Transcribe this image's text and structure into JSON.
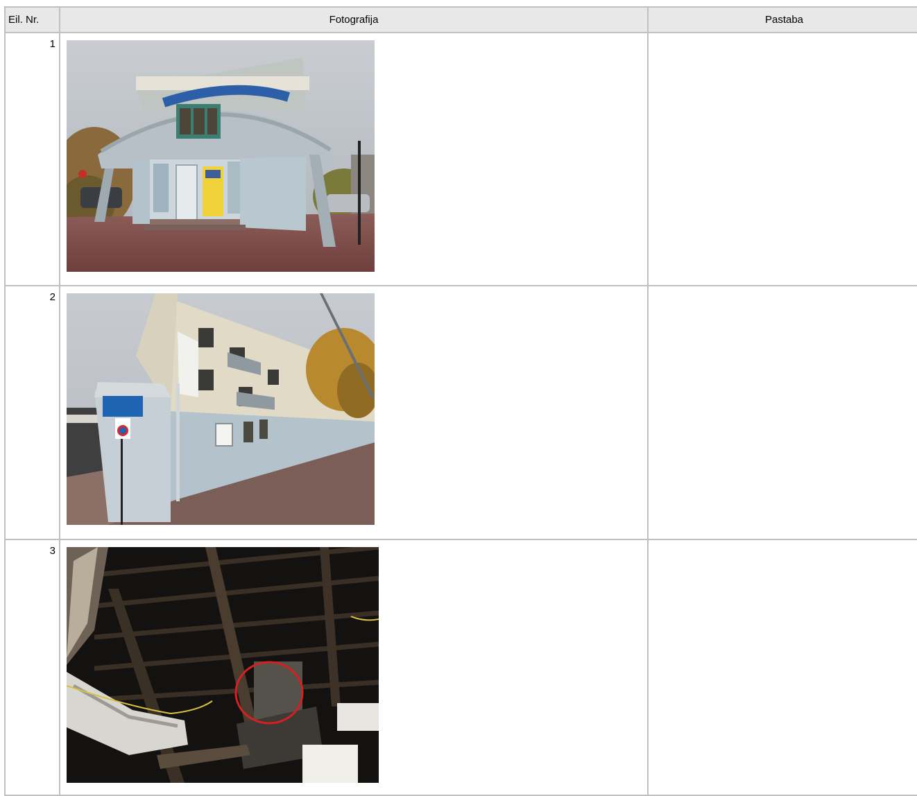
{
  "table": {
    "headers": {
      "nr": "Eil. Nr.",
      "photo": "Fotografija",
      "note": "Pastaba"
    },
    "rows": [
      {
        "nr": "1",
        "photo_subject": "building-front-photo",
        "note": ""
      },
      {
        "nr": "2",
        "photo_subject": "building-side-photo",
        "note": ""
      },
      {
        "nr": "3",
        "photo_subject": "attic-roof-photo",
        "note": ""
      }
    ]
  }
}
